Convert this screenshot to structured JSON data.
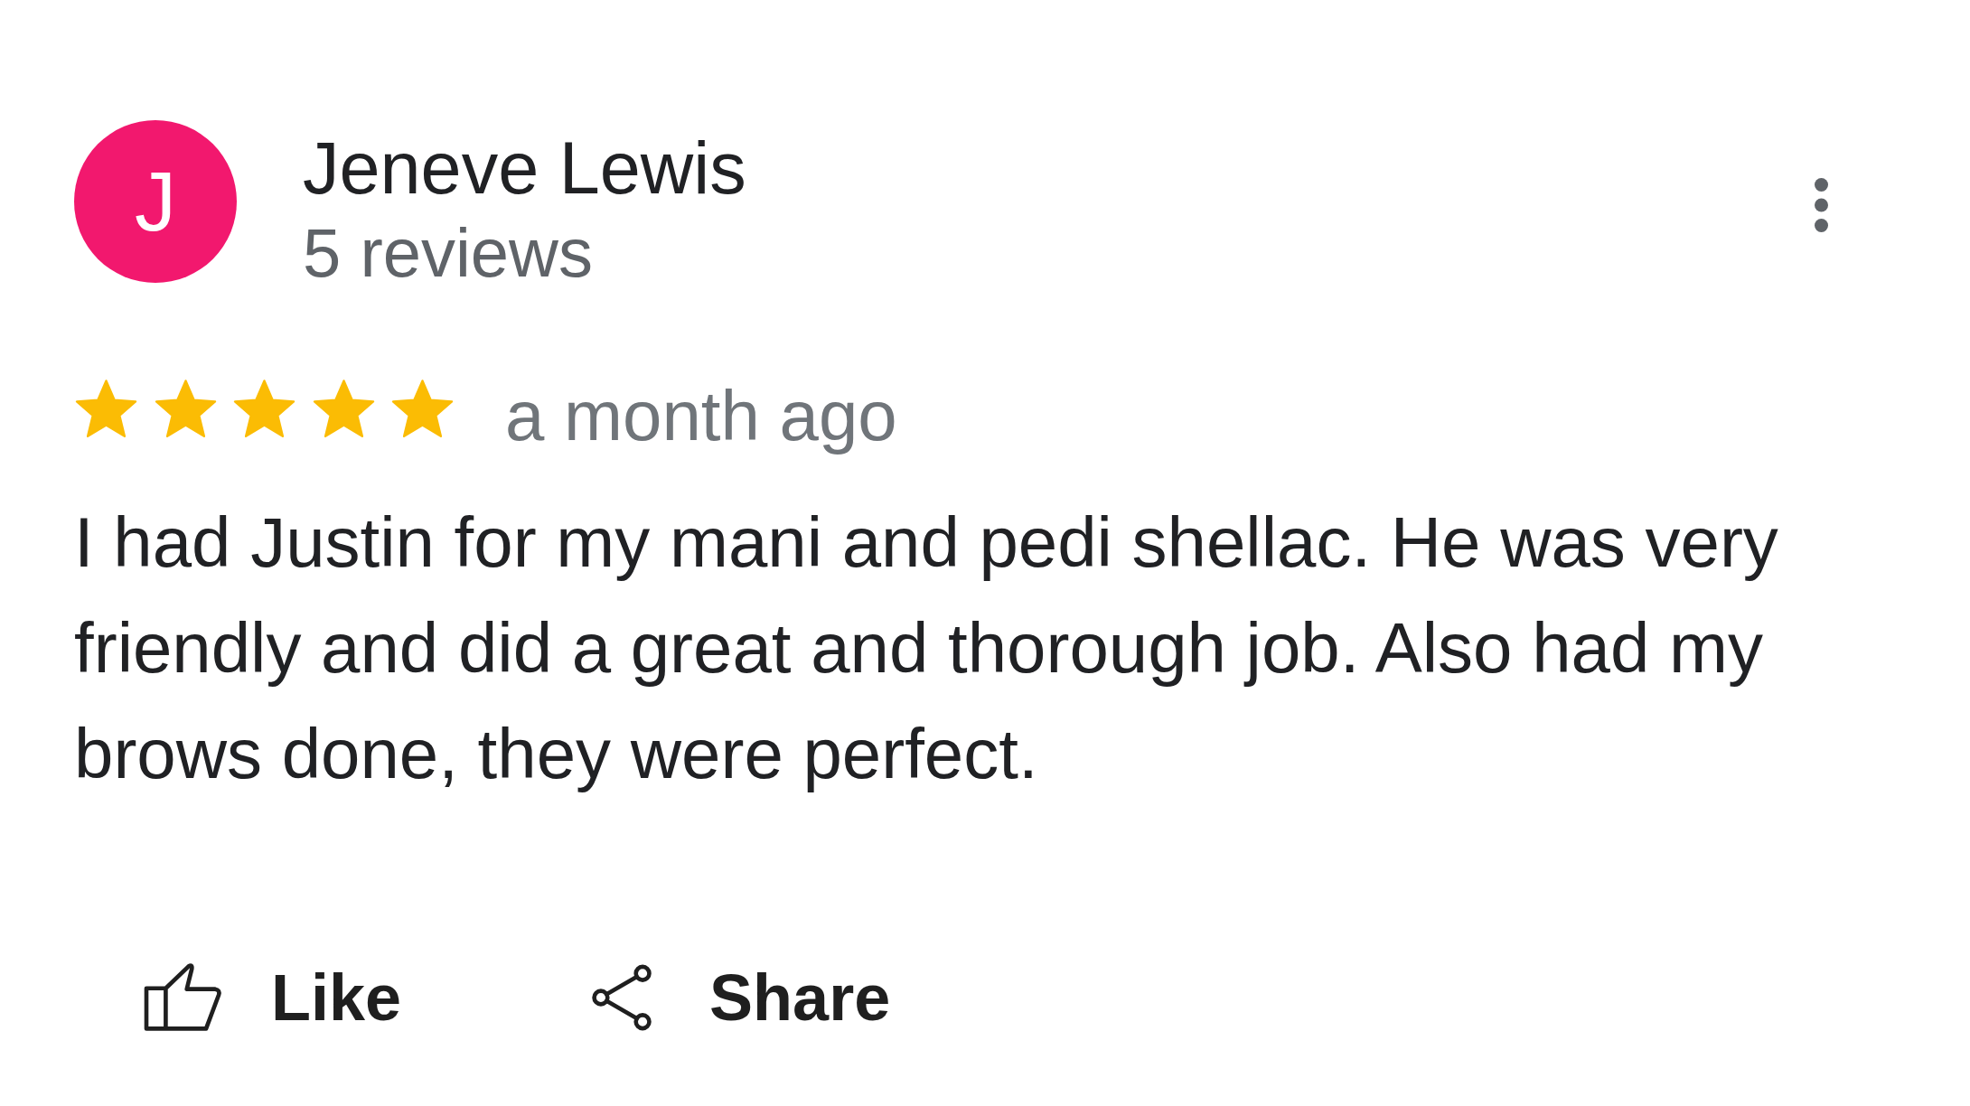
{
  "review": {
    "author": {
      "initial": "J",
      "name": "Jeneve Lewis",
      "reviews": "5 reviews"
    },
    "stars": 5,
    "time": "a month ago",
    "text": "I had Justin for my mani and pedi shellac. He was very friendly and did a great and thorough job. Also had my brows done, they were perfect.",
    "actions": [
      {
        "kind": "like",
        "label": "Like"
      },
      {
        "kind": "share",
        "label": "Share"
      }
    ]
  }
}
